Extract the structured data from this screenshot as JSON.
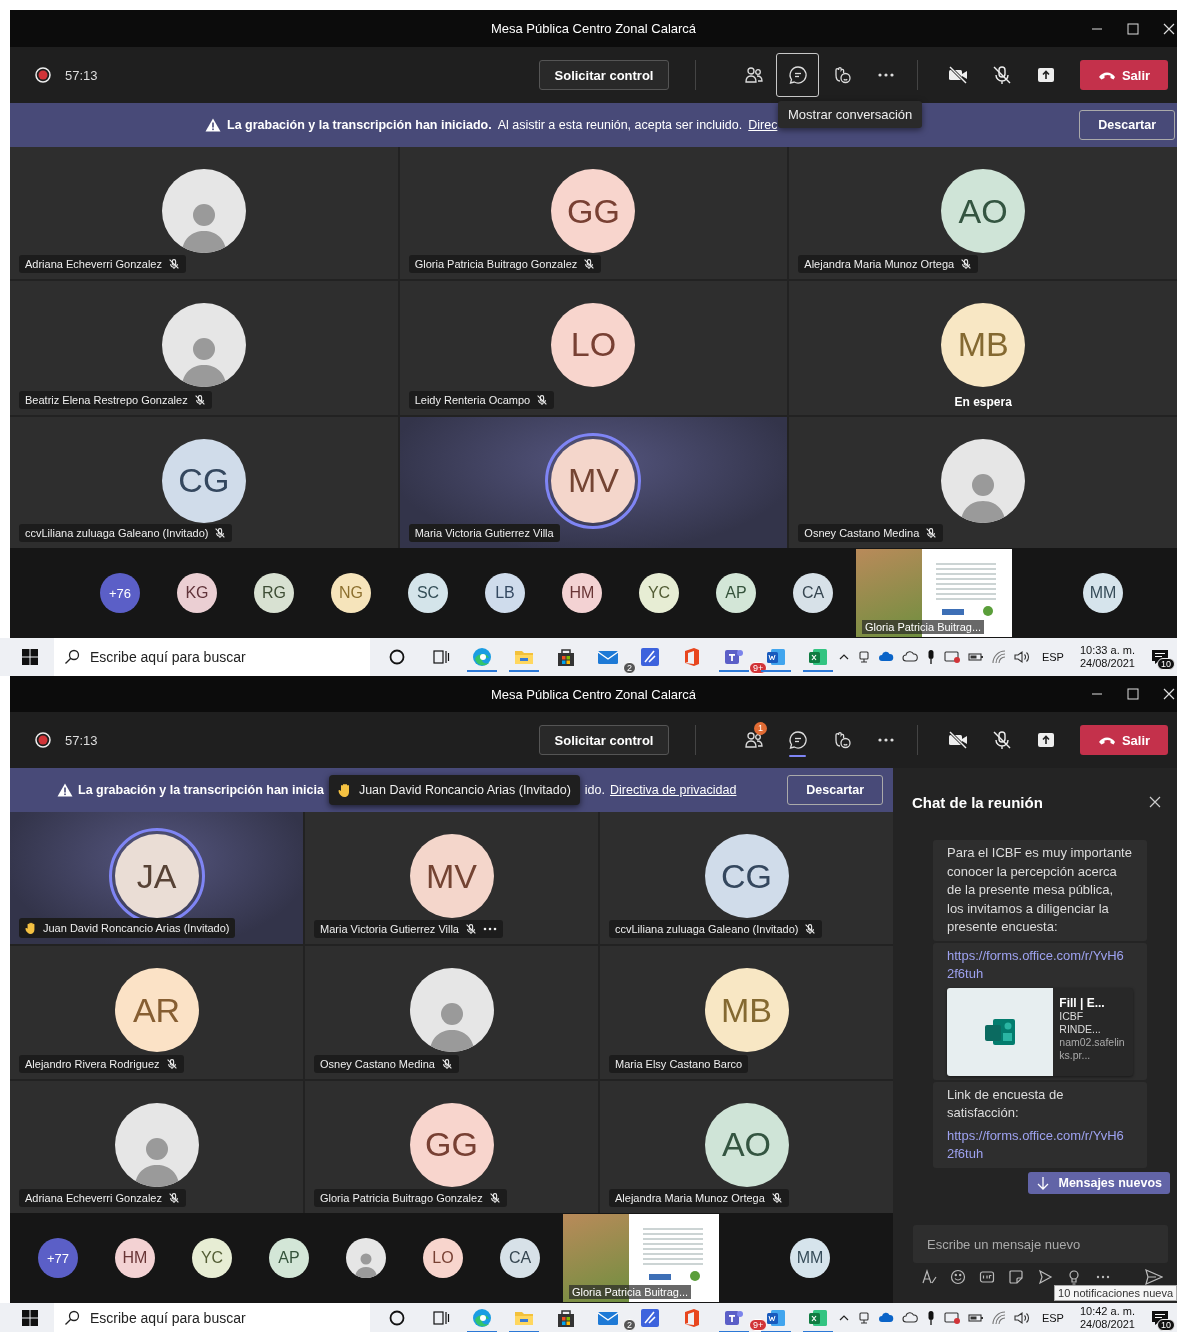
{
  "windows": [
    {
      "title": "Mesa Pública Centro Zonal Calarcá",
      "timer": "57:13",
      "control_button": "Solicitar control",
      "toolbar": [
        {
          "kind": "people",
          "selected": false,
          "focused": false
        },
        {
          "kind": "chat",
          "selected": false,
          "focused": true,
          "tooltip": "Mostrar conversación"
        },
        {
          "kind": "reactions",
          "selected": false,
          "focused": false
        },
        {
          "kind": "more",
          "selected": false,
          "focused": false
        }
      ],
      "leave_button": "Salir",
      "banner": {
        "segments": [
          {
            "kind": "bold",
            "text": "La grabación y la transcripción han iniciado."
          },
          {
            "kind": "text",
            "text": "Al asistir a esta reunión, acepta ser incluido."
          },
          {
            "kind": "link",
            "text": "Direc"
          }
        ],
        "dismiss": "Descartar"
      },
      "tiles": [
        {
          "kind": "photo",
          "name": "Adriana Echeverri Gonzalez",
          "muted": true,
          "speaking": false,
          "hand_raised": false,
          "more": false
        },
        {
          "kind": "initials",
          "initials": "GG",
          "color": "#f8d5cd",
          "name": "Gloria Patricia Buitrago Gonzalez",
          "muted": true,
          "speaking": false,
          "hand_raised": false,
          "more": false
        },
        {
          "kind": "initials",
          "initials": "AO",
          "color": "#cfe4d7",
          "name": "Alejandra Maria Munoz Ortega",
          "muted": true,
          "speaking": false,
          "hand_raised": false,
          "more": false
        },
        {
          "kind": "photo",
          "name": "Beatriz Elena Restrepo Gonzalez",
          "muted": true,
          "speaking": false,
          "hand_raised": false,
          "more": false
        },
        {
          "kind": "initials",
          "initials": "LO",
          "color": "#f8d5cd",
          "name": "Leidy Renteria Ocampo",
          "muted": true,
          "speaking": false,
          "hand_raised": false,
          "more": false
        },
        {
          "kind": "initials",
          "initials": "MB",
          "color": "#f8e7c4",
          "status": "En espera",
          "speaking": false
        },
        {
          "kind": "initials",
          "initials": "CG",
          "color": "#d0dcea",
          "name": "ccvLiliana zuluaga Galeano (Invitado)",
          "muted": true,
          "speaking": false,
          "hand_raised": false,
          "more": false
        },
        {
          "kind": "initials",
          "initials": "MV",
          "color": "#f4d6cb",
          "name": "Maria Victoria Gutierrez Villa",
          "muted": false,
          "speaking": true,
          "hand_raised": false,
          "more": false
        },
        {
          "kind": "photo",
          "name": "Osney Castano Medina",
          "muted": true,
          "speaking": false,
          "hand_raised": false,
          "more": false
        }
      ],
      "strip": [
        {
          "kind": "count",
          "text": "+76"
        },
        {
          "kind": "initials",
          "initials": "KG",
          "color": "#ebcfd3"
        },
        {
          "kind": "initials",
          "initials": "RG",
          "color": "#d8e1d2"
        },
        {
          "kind": "initials",
          "initials": "NG",
          "color": "#f6e4bb"
        },
        {
          "kind": "initials",
          "initials": "SC",
          "color": "#d4e4ea"
        },
        {
          "kind": "initials",
          "initials": "LB",
          "color": "#cfdcec"
        },
        {
          "kind": "initials",
          "initials": "HM",
          "color": "#f3d2d3"
        },
        {
          "kind": "initials",
          "initials": "YC",
          "color": "#e7edd4"
        },
        {
          "kind": "initials",
          "initials": "AP",
          "color": "#d3e6d7"
        },
        {
          "kind": "initials",
          "initials": "CA",
          "color": "#d7e1e8"
        },
        {
          "kind": "screen",
          "label": "Gloria Patricia Buitrag..."
        },
        {
          "kind": "initials",
          "initials": "MM",
          "color": "#d6e4ec"
        }
      ],
      "taskbar": {
        "search": "Escribe aquí para buscar",
        "apps": [
          {
            "kind": "browser",
            "running": true
          },
          {
            "kind": "folder",
            "running": true
          },
          {
            "kind": "store",
            "running": false
          },
          {
            "kind": "mail",
            "running": false,
            "badge": "2"
          },
          {
            "kind": "whiteboard",
            "running": false
          },
          {
            "kind": "office",
            "running": false
          },
          {
            "kind": "teams",
            "running": true,
            "badge": "9+"
          },
          {
            "kind": "word",
            "running": true
          },
          {
            "kind": "excel",
            "running": true
          }
        ],
        "language": "ESP",
        "time": "10:33 a. m.",
        "date": "24/08/2021",
        "notifications": "10"
      }
    },
    {
      "title": "Mesa Pública Centro Zonal Calarcá",
      "timer": "57:13",
      "control_button": "Solicitar control",
      "toolbar": [
        {
          "kind": "people",
          "selected": false,
          "focused": false,
          "badge": "1"
        },
        {
          "kind": "chat",
          "selected": true,
          "focused": false
        },
        {
          "kind": "reactions",
          "selected": false,
          "focused": false
        },
        {
          "kind": "more",
          "selected": false,
          "focused": false
        }
      ],
      "leave_button": "Salir",
      "banner": {
        "segments": [
          {
            "kind": "bold",
            "text": "La grabación y la transcripción han inicia"
          },
          {
            "kind": "toast",
            "text": "Juan David Roncancio Arias (Invitado)"
          },
          {
            "kind": "text",
            "text": "ido."
          },
          {
            "kind": "link",
            "text": "Directiva de privacidad"
          }
        ],
        "dismiss": "Descartar"
      },
      "tiles": [
        {
          "kind": "initials",
          "initials": "JA",
          "color": "#eaddd5",
          "name": "Juan David Roncancio Arias (Invitado)",
          "muted": false,
          "speaking": true,
          "hand_raised": true,
          "more": false
        },
        {
          "kind": "initials",
          "initials": "MV",
          "color": "#f4d6cb",
          "name": "Maria Victoria Gutierrez Villa",
          "muted": true,
          "speaking": false,
          "hand_raised": false,
          "more": true
        },
        {
          "kind": "initials",
          "initials": "CG",
          "color": "#d0dcea",
          "name": "ccvLiliana zuluaga Galeano (Invitado)",
          "muted": true,
          "speaking": false,
          "hand_raised": false,
          "more": false
        },
        {
          "kind": "initials",
          "initials": "AR",
          "color": "#fbe2c6",
          "name": "Alejandro Rivera Rodriguez",
          "muted": true,
          "speaking": false,
          "hand_raised": false,
          "more": false
        },
        {
          "kind": "photo",
          "name": "Osney Castano Medina",
          "muted": true,
          "speaking": false,
          "hand_raised": false,
          "more": false
        },
        {
          "kind": "initials",
          "initials": "MB",
          "color": "#f8e7c4",
          "name": "Maria Elsy Castano Barco",
          "muted": false,
          "speaking": false,
          "hand_raised": false,
          "more": false
        },
        {
          "kind": "photo",
          "name": "Adriana Echeverri Gonzalez",
          "muted": true,
          "speaking": false,
          "hand_raised": false,
          "more": false
        },
        {
          "kind": "initials",
          "initials": "GG",
          "color": "#f8d5cd",
          "name": "Gloria Patricia Buitrago Gonzalez",
          "muted": true,
          "speaking": false,
          "hand_raised": false,
          "more": false
        },
        {
          "kind": "initials",
          "initials": "AO",
          "color": "#cfe4d7",
          "name": "Alejandra Maria Munoz Ortega",
          "muted": true,
          "speaking": false,
          "hand_raised": false,
          "more": false
        }
      ],
      "strip": [
        {
          "kind": "count",
          "text": "+77"
        },
        {
          "kind": "initials",
          "initials": "HM",
          "color": "#f3d2d3"
        },
        {
          "kind": "initials",
          "initials": "YC",
          "color": "#e7edd4"
        },
        {
          "kind": "initials",
          "initials": "AP",
          "color": "#d3e6d7"
        },
        {
          "kind": "photo"
        },
        {
          "kind": "initials",
          "initials": "LO",
          "color": "#f8d5cd"
        },
        {
          "kind": "initials",
          "initials": "CA",
          "color": "#d7e1e8"
        },
        {
          "kind": "screen",
          "label": "Gloria Patricia Buitrag..."
        },
        {
          "kind": "initials",
          "initials": "MM",
          "color": "#d6e4ec"
        }
      ],
      "chat": {
        "title": "Chat de la reunión",
        "messages": [
          {
            "text": "Para el ICBF es muy importante conocer la percepción acerca de la presente mesa pública, los invitamos a diligenciar la presente encuesta:"
          },
          {
            "link": "https://forms.office.com/r/YvH62f6tuh",
            "card": {
              "title": "Fill | E...",
              "description": "ICBF RINDE...",
              "host": "nam02.safelinks.pr..."
            }
          },
          {
            "text": "Link de encuesta de satisfacción:",
            "link": "https://forms.office.com/r/YvH62f6tuh"
          }
        ],
        "new_messages": "Mensajes nuevos",
        "placeholder": "Escribe un mensaje nuevo",
        "notification_tooltip": "10 notificaciones nueva"
      },
      "taskbar": {
        "search": "Escribe aquí para buscar",
        "apps": [
          {
            "kind": "browser",
            "running": true
          },
          {
            "kind": "folder",
            "running": true
          },
          {
            "kind": "store",
            "running": false
          },
          {
            "kind": "mail",
            "running": false,
            "badge": "2"
          },
          {
            "kind": "whiteboard",
            "running": false
          },
          {
            "kind": "office",
            "running": false
          },
          {
            "kind": "teams",
            "running": true,
            "badge": "9+"
          },
          {
            "kind": "word",
            "running": true
          },
          {
            "kind": "excel",
            "running": true
          }
        ],
        "language": "ESP",
        "time": "10:42 a. m.",
        "date": "24/08/2021",
        "notifications": "10"
      }
    }
  ]
}
